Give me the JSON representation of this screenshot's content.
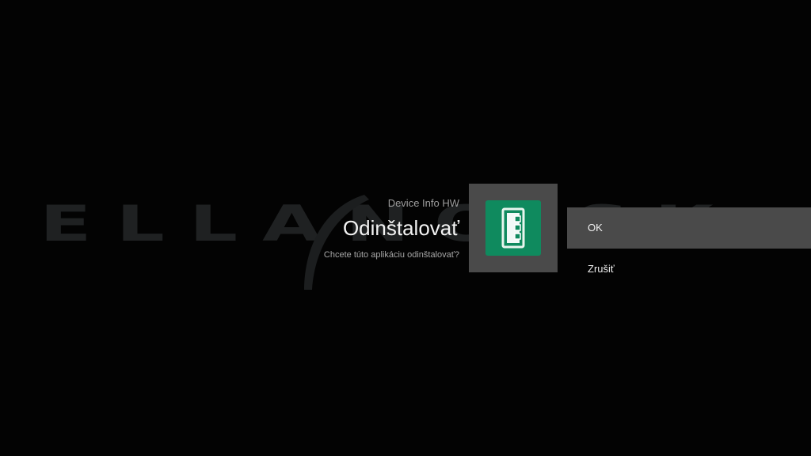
{
  "watermark": {
    "text": "ELLANO.SK",
    "swoosh_icon": "watermark-swoosh"
  },
  "dialog": {
    "app_name": "Device Info HW",
    "title": "Odinštalovať",
    "message": "Chcete túto aplikáciu odinštalovať?",
    "app_icon": "device-info-icon",
    "app_icon_color": "#0f8a5e"
  },
  "actions": [
    {
      "label": "OK",
      "selected": true
    },
    {
      "label": "Zrušiť",
      "selected": false
    }
  ],
  "colors": {
    "background": "#030303",
    "selected_action": "#4a4a4a",
    "icon_tile": "#4a4a4a"
  }
}
